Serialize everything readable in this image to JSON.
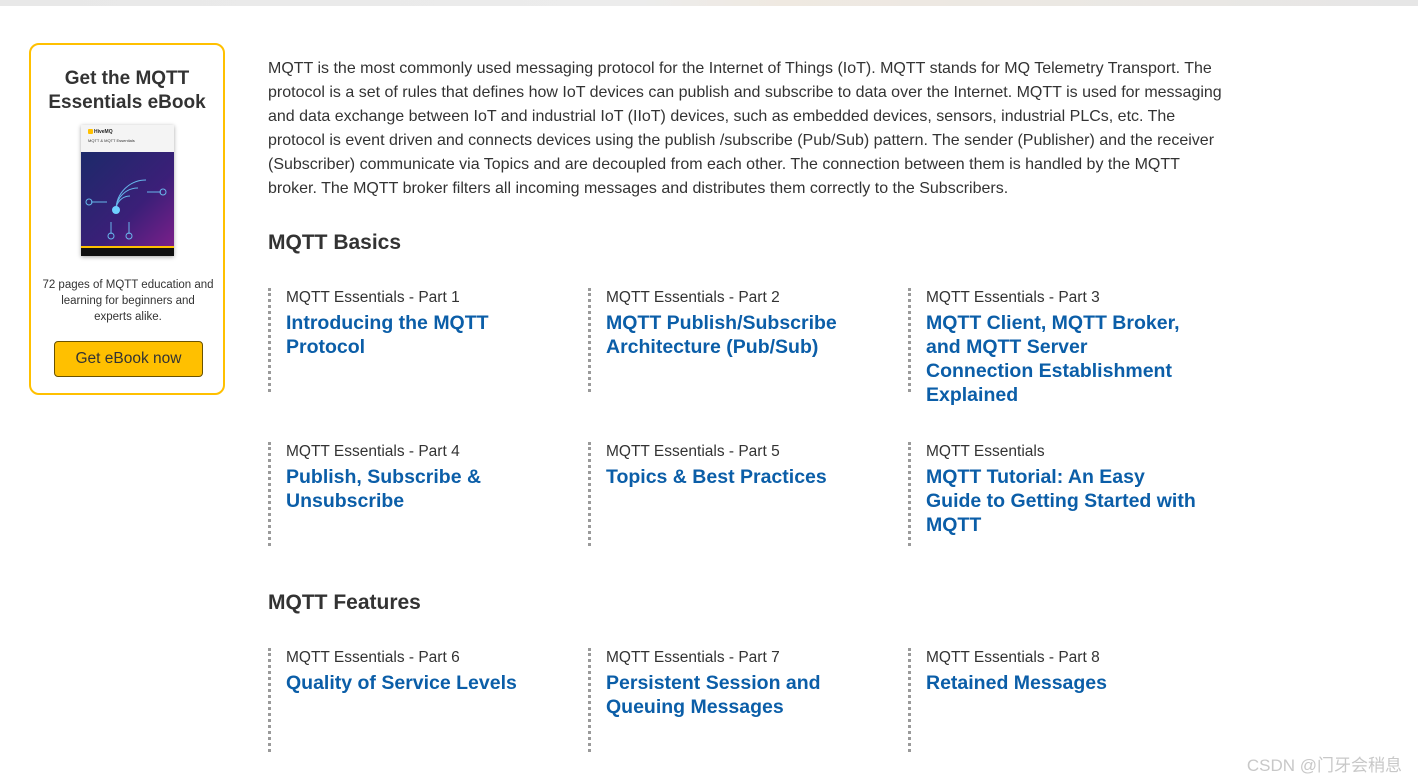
{
  "sidebar": {
    "ebook_title": "Get the MQTT Essentials eBook",
    "cover_brand": "HiveMQ",
    "cover_title": "MQTT & MQTT Essentials",
    "description": "72 pages of MQTT education and learning for beginners and experts alike.",
    "button_label": "Get eBook now",
    "accent_color": "#ffc000"
  },
  "intro": "MQTT is the most commonly used messaging protocol for the Internet of Things (IoT). MQTT stands for MQ Telemetry Transport. The protocol is a set of rules that defines how IoT devices can publish and subscribe to data over the Internet. MQTT is used for messaging and data exchange between IoT and industrial IoT (IIoT) devices, such as embedded devices, sensors, industrial PLCs, etc. The protocol is event driven and connects devices using the publish /subscribe (Pub/Sub) pattern. The sender (Publisher) and the receiver (Subscriber) communicate via Topics and are decoupled from each other. The connection between them is handled by the MQTT broker. The MQTT broker filters all incoming messages and distributes them correctly to the Subscribers.",
  "sections": [
    {
      "title": "MQTT Basics",
      "items": [
        {
          "kicker": "MQTT Essentials - Part 1",
          "title": "Introducing the MQTT Protocol"
        },
        {
          "kicker": "MQTT Essentials - Part 2",
          "title": "MQTT Publish/Subscribe Architecture (Pub/Sub)"
        },
        {
          "kicker": "MQTT Essentials - Part 3",
          "title": "MQTT Client, MQTT Broker, and MQTT Server Connection Establishment Explained"
        },
        {
          "kicker": "MQTT Essentials - Part 4",
          "title": "Publish, Subscribe & Unsubscribe"
        },
        {
          "kicker": "MQTT Essentials - Part 5",
          "title": "Topics & Best Practices"
        },
        {
          "kicker": "MQTT Essentials",
          "title": "MQTT Tutorial: An Easy Guide to Getting Started with MQTT"
        }
      ]
    },
    {
      "title": "MQTT Features",
      "items": [
        {
          "kicker": "MQTT Essentials - Part 6",
          "title": "Quality of Service Levels"
        },
        {
          "kicker": "MQTT Essentials - Part 7",
          "title": "Persistent Session and Queuing Messages"
        },
        {
          "kicker": "MQTT Essentials - Part 8",
          "title": "Retained Messages"
        }
      ]
    }
  ],
  "watermark": "CSDN @门牙会稍息",
  "link_color": "#0b5ea8"
}
